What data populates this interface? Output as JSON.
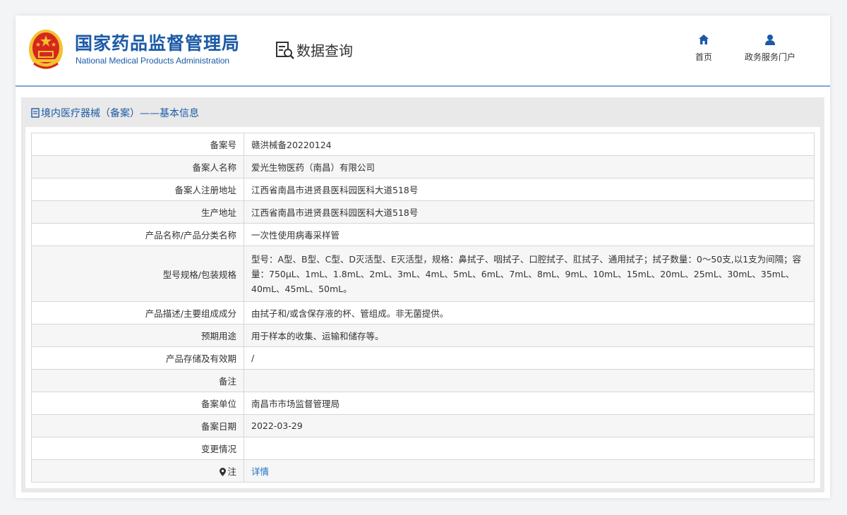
{
  "header": {
    "brand_cn": "国家药品监督管理局",
    "brand_en": "National Medical Products Administration",
    "query_title": "数据查询",
    "nav": {
      "home_label": "首页",
      "portal_label": "政务服务门户"
    }
  },
  "section": {
    "title": "境内医疗器械（备案）——基本信息"
  },
  "rows": [
    {
      "label": "备案号",
      "value": "赣洪械备20220124"
    },
    {
      "label": "备案人名称",
      "value": "爱光生物医药（南昌）有限公司"
    },
    {
      "label": "备案人注册地址",
      "value": "江西省南昌市进贤县医科园医科大道518号"
    },
    {
      "label": "生产地址",
      "value": "江西省南昌市进贤县医科园医科大道518号"
    },
    {
      "label": "产品名称/产品分类名称",
      "value": "一次性使用病毒采样管"
    },
    {
      "label": "型号规格/包装规格",
      "value": "型号：A型、B型、C型、D灭活型、E灭活型，规格：鼻拭子、咽拭子、口腔拭子、肛拭子、通用拭子；拭子数量：0～50支,以1支为间隔；容量：750μL、1mL、1.8mL、2mL、3mL、4mL、5mL、6mL、7mL、8mL、9mL、10mL、15mL、20mL、25mL、30mL、35mL、40mL、45mL、50mL。"
    },
    {
      "label": "产品描述/主要组成成分",
      "value": "由拭子和/或含保存液的杯、管组成。非无菌提供。"
    },
    {
      "label": "预期用途",
      "value": "用于样本的收集、运输和储存等。"
    },
    {
      "label": "产品存储及有效期",
      "value": "/"
    },
    {
      "label": "备注",
      "value": ""
    },
    {
      "label": "备案单位",
      "value": "南昌市市场监督管理局"
    },
    {
      "label": "备案日期",
      "value": "2022-03-29"
    },
    {
      "label": "变更情况",
      "value": ""
    },
    {
      "label": "注",
      "value": "详情"
    }
  ],
  "colors": {
    "brand_blue": "#1b5aa6",
    "link_blue": "#1b6fc2",
    "emblem_red": "#d7261e",
    "emblem_gold": "#f2c230"
  }
}
